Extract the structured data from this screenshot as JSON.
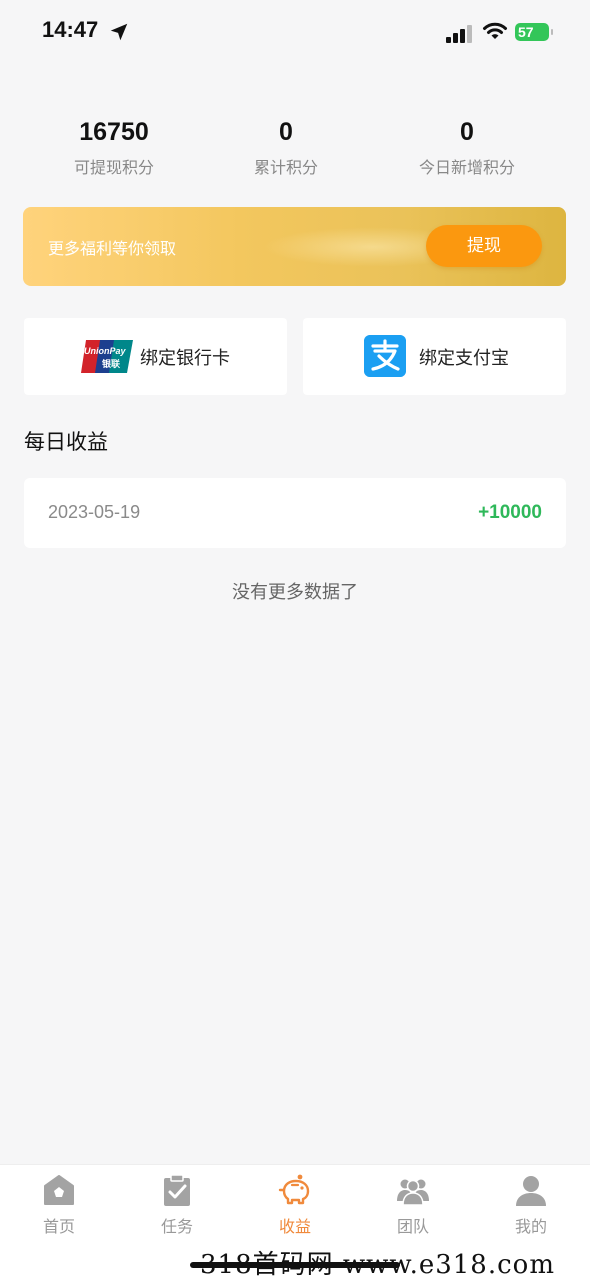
{
  "status_bar": {
    "time": "14:47",
    "battery": "57",
    "icons": [
      "location-arrow-icon",
      "cellular-signal-icon",
      "wifi-icon",
      "battery-icon"
    ]
  },
  "stats": [
    {
      "value": "16750",
      "label": "可提现积分"
    },
    {
      "value": "0",
      "label": "累计积分"
    },
    {
      "value": "0",
      "label": "今日新增积分"
    }
  ],
  "banner": {
    "text": "更多福利等你领取",
    "button_label": "提现"
  },
  "bind": {
    "bank_label": "绑定银行卡",
    "alipay_label": "绑定支付宝",
    "unionpay_logo_text": "UnionPay 银联"
  },
  "daily": {
    "title": "每日收益",
    "records": [
      {
        "date": "2023-05-19",
        "amount": "+10000"
      }
    ],
    "no_more": "没有更多数据了"
  },
  "tabs": [
    {
      "label": "首页",
      "icon": "home-icon",
      "active": false
    },
    {
      "label": "任务",
      "icon": "task-clipboard-icon",
      "active": false
    },
    {
      "label": "收益",
      "icon": "piggy-bank-icon",
      "active": true
    },
    {
      "label": "团队",
      "icon": "team-icon",
      "active": false
    },
    {
      "label": "我的",
      "icon": "profile-icon",
      "active": false
    }
  ],
  "watermark": "318首码网 www.e318.com",
  "colors": {
    "accent_orange": "#fb980f",
    "active_tab": "#f08a3c",
    "amount_green": "#2fb85a",
    "alipay_blue": "#1b9ff2",
    "battery_green": "#33c659"
  }
}
